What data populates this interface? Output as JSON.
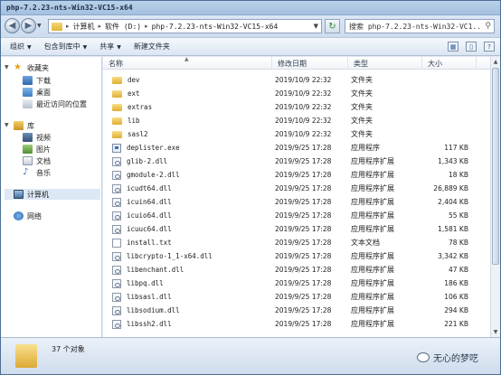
{
  "window": {
    "title": "php-7.2.23-nts-Win32-VC15-x64"
  },
  "address": {
    "crumbs": [
      "计算机",
      "软件 (D:)",
      "php-7.2.23-nts-Win32-VC15-x64"
    ]
  },
  "search": {
    "placeholder": "搜索 php-7.2.23-nts-Win32-VC1..."
  },
  "toolbar": {
    "organize": "组织",
    "include_library": "包含到库中",
    "share": "共享",
    "new_folder": "新建文件夹"
  },
  "nav": {
    "favorites": "收藏夹",
    "downloads": "下载",
    "desktop": "桌面",
    "recent": "最近访问的位置",
    "libraries": "库",
    "videos": "视频",
    "pictures": "图片",
    "documents": "文档",
    "music": "音乐",
    "computer": "计算机",
    "network": "网络"
  },
  "columns": {
    "name": "名称",
    "date": "修改日期",
    "type": "类型",
    "size": "大小"
  },
  "files": [
    {
      "name": "dev",
      "date": "2019/10/9 22:32",
      "type": "文件夹",
      "size": "",
      "kind": "folder"
    },
    {
      "name": "ext",
      "date": "2019/10/9 22:32",
      "type": "文件夹",
      "size": "",
      "kind": "folder"
    },
    {
      "name": "extras",
      "date": "2019/10/9 22:32",
      "type": "文件夹",
      "size": "",
      "kind": "folder"
    },
    {
      "name": "lib",
      "date": "2019/10/9 22:32",
      "type": "文件夹",
      "size": "",
      "kind": "folder"
    },
    {
      "name": "sasl2",
      "date": "2019/10/9 22:32",
      "type": "文件夹",
      "size": "",
      "kind": "folder"
    },
    {
      "name": "deplister.exe",
      "date": "2019/9/25 17:28",
      "type": "应用程序",
      "size": "117 KB",
      "kind": "exe"
    },
    {
      "name": "glib-2.dll",
      "date": "2019/9/25 17:28",
      "type": "应用程序扩展",
      "size": "1,343 KB",
      "kind": "dll"
    },
    {
      "name": "gmodule-2.dll",
      "date": "2019/9/25 17:28",
      "type": "应用程序扩展",
      "size": "18 KB",
      "kind": "dll"
    },
    {
      "name": "icudt64.dll",
      "date": "2019/9/25 17:28",
      "type": "应用程序扩展",
      "size": "26,889 KB",
      "kind": "dll"
    },
    {
      "name": "icuin64.dll",
      "date": "2019/9/25 17:28",
      "type": "应用程序扩展",
      "size": "2,404 KB",
      "kind": "dll"
    },
    {
      "name": "icuio64.dll",
      "date": "2019/9/25 17:28",
      "type": "应用程序扩展",
      "size": "55 KB",
      "kind": "dll"
    },
    {
      "name": "icuuc64.dll",
      "date": "2019/9/25 17:28",
      "type": "应用程序扩展",
      "size": "1,581 KB",
      "kind": "dll"
    },
    {
      "name": "install.txt",
      "date": "2019/9/25 17:28",
      "type": "文本文档",
      "size": "78 KB",
      "kind": "txt"
    },
    {
      "name": "libcrypto-1_1-x64.dll",
      "date": "2019/9/25 17:28",
      "type": "应用程序扩展",
      "size": "3,342 KB",
      "kind": "dll"
    },
    {
      "name": "libenchant.dll",
      "date": "2019/9/25 17:28",
      "type": "应用程序扩展",
      "size": "47 KB",
      "kind": "dll"
    },
    {
      "name": "libpq.dll",
      "date": "2019/9/25 17:28",
      "type": "应用程序扩展",
      "size": "186 KB",
      "kind": "dll"
    },
    {
      "name": "libsasl.dll",
      "date": "2019/9/25 17:28",
      "type": "应用程序扩展",
      "size": "106 KB",
      "kind": "dll"
    },
    {
      "name": "libsodium.dll",
      "date": "2019/9/25 17:28",
      "type": "应用程序扩展",
      "size": "294 KB",
      "kind": "dll"
    },
    {
      "name": "libssh2.dll",
      "date": "2019/9/25 17:28",
      "type": "应用程序扩展",
      "size": "221 KB",
      "kind": "dll"
    }
  ],
  "status": {
    "count": "37 个对象",
    "watermark": "无心的梦呓"
  }
}
